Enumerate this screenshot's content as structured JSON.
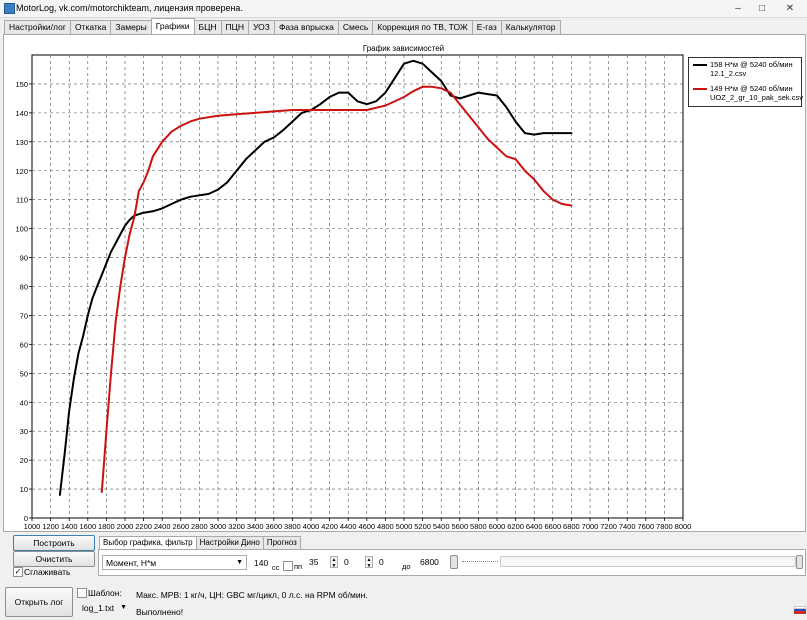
{
  "window": {
    "title": "MotorLog, vk.com/motorchikteam, лицензия проверена.",
    "minimize": "–",
    "maximize": "□",
    "close": "✕"
  },
  "tabs": [
    "Настройки/лог",
    "Откатка",
    "Замеры",
    "Графики",
    "БЦН",
    "ПЦН",
    "УОЗ",
    "Фаза впрыска",
    "Смесь",
    "Коррекция по ТВ, ТОЖ",
    "E-газ",
    "Калькулятор"
  ],
  "active_tab": "Графики",
  "chart_data": {
    "type": "line",
    "title": "График зависимостей",
    "xlim": [
      1000,
      8000
    ],
    "ylim": [
      0,
      160
    ],
    "x_ticks": [
      1000,
      1200,
      1400,
      1600,
      1800,
      2000,
      2200,
      2400,
      2600,
      2800,
      3000,
      3200,
      3400,
      3600,
      3800,
      4000,
      4200,
      4400,
      4600,
      4800,
      5000,
      5200,
      5400,
      5600,
      5800,
      6000,
      6200,
      6400,
      6600,
      6800,
      7000,
      7200,
      7400,
      7600,
      7800,
      8000
    ],
    "y_ticks": [
      0,
      10,
      20,
      30,
      40,
      50,
      60,
      70,
      80,
      90,
      100,
      110,
      120,
      130,
      140,
      150
    ],
    "grid": true,
    "legend_position": "right",
    "series": [
      {
        "name": "158 Н*м @ 5240 об/мин",
        "file": "12.1_2.csv",
        "color": "#000000",
        "x": [
          1300,
          1350,
          1400,
          1450,
          1500,
          1550,
          1600,
          1650,
          1700,
          1750,
          1800,
          1850,
          1900,
          1950,
          2000,
          2050,
          2100,
          2150,
          2200,
          2300,
          2400,
          2500,
          2600,
          2700,
          2800,
          2900,
          3000,
          3100,
          3200,
          3300,
          3400,
          3500,
          3600,
          3700,
          3800,
          3900,
          4000,
          4100,
          4200,
          4300,
          4400,
          4500,
          4600,
          4700,
          4800,
          4900,
          5000,
          5100,
          5200,
          5300,
          5400,
          5500,
          5600,
          5700,
          5800,
          5900,
          6000,
          6100,
          6200,
          6300,
          6400,
          6500,
          6600,
          6700,
          6800
        ],
        "y": [
          8,
          22,
          37,
          48,
          57,
          63,
          70,
          76,
          80,
          84,
          88,
          92,
          95,
          98,
          101,
          103,
          104.5,
          105,
          105.5,
          106,
          107,
          108.5,
          110,
          111,
          111.5,
          112,
          113.5,
          116,
          120,
          124,
          127,
          130,
          131.5,
          134,
          137,
          140,
          141,
          143,
          145.5,
          147,
          147,
          144,
          143,
          144,
          147,
          152,
          157,
          158,
          157,
          154,
          151,
          146,
          145,
          146,
          147,
          146.5,
          146,
          142,
          137,
          133,
          132.5,
          133,
          133,
          133,
          133
        ],
        "peak": "158 Н*м @ 5240 об/мин"
      },
      {
        "name": "149 Н*м @ 5240 об/мин",
        "file": "UOZ_2_gr_10_pak_sek.csv",
        "color": "#cc1111",
        "x": [
          1750,
          1800,
          1850,
          1900,
          1950,
          2000,
          2050,
          2100,
          2150,
          2200,
          2250,
          2300,
          2400,
          2500,
          2600,
          2700,
          2800,
          2900,
          3000,
          3200,
          3400,
          3600,
          3800,
          4000,
          4200,
          4400,
          4600,
          4800,
          5000,
          5100,
          5200,
          5300,
          5400,
          5500,
          5600,
          5700,
          5800,
          5900,
          6000,
          6100,
          6200,
          6300,
          6400,
          6500,
          6600,
          6700,
          6800
        ],
        "y": [
          9,
          30,
          50,
          68,
          80,
          90,
          98,
          104,
          113,
          116,
          120,
          125,
          130,
          133.5,
          135.5,
          137,
          138,
          138.5,
          139,
          139.5,
          140,
          140.5,
          141,
          141,
          141,
          141,
          141,
          142.5,
          145.5,
          147.5,
          149,
          149,
          148.5,
          147,
          143,
          139,
          135,
          131,
          128,
          125,
          124,
          120,
          117,
          113,
          110,
          108.5,
          108
        ],
        "peak": "149 Н*м @ 5240 об/мин"
      }
    ]
  },
  "left_panel": {
    "build_button": "Построить",
    "clear_button": "Очистить",
    "smooth_label": "Сглаживать",
    "smooth_checked": true
  },
  "subtabs": [
    "Выбор графика, фильтр",
    "Настройки Дино",
    "Прогноз"
  ],
  "filter": {
    "parameter": "Момент, Н*м",
    "value1": "140",
    "unit_cc": "cc",
    "pp_label": "пп",
    "value2": "35",
    "value3": "0",
    "value4": "0",
    "to_label": "до",
    "value5": "6800"
  },
  "bottom": {
    "open_log_button": "Открыть лог",
    "template_label": "Шаблон:",
    "log_file": "log_1.txt",
    "info": "Макс. МРВ: 1 кг/ч, ЦН: GBC мг/цикл, 0 л.с. на RPM об/мин.",
    "status": "Выполнено!"
  }
}
